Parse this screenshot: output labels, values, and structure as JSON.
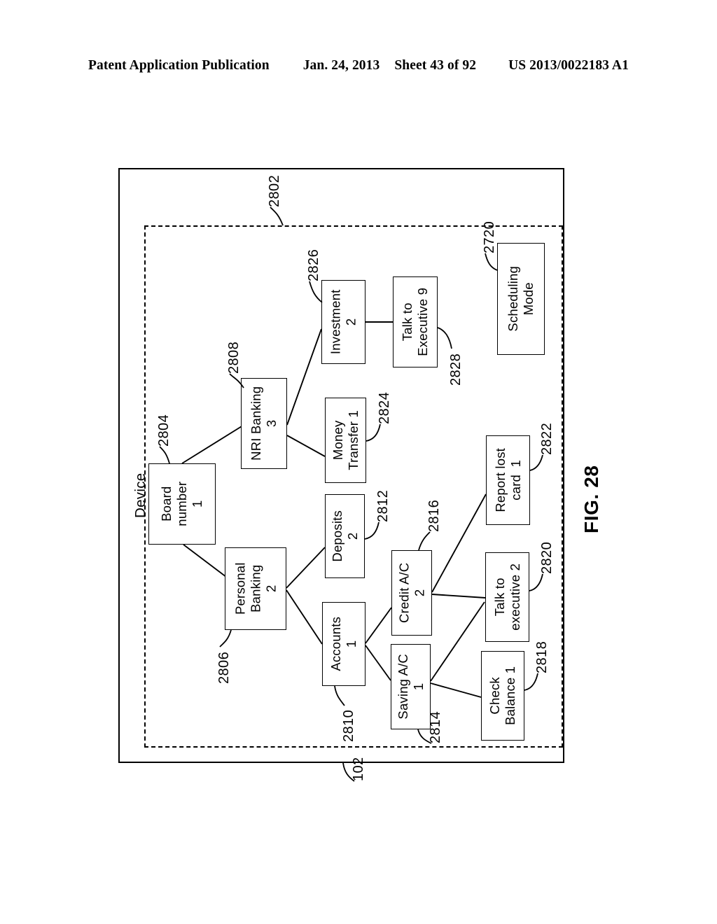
{
  "header": {
    "publication": "Patent Application Publication",
    "date": "Jan. 24, 2013",
    "sheet": "Sheet 43 of 92",
    "number": "US 2013/0022183 A1"
  },
  "figure": {
    "label": "FIG. 28",
    "device_label": "Device",
    "outer_frame_ref": "102",
    "inner_frame_ref": "2802"
  },
  "nodes": [
    {
      "id": "board-number",
      "text": "Board\nnumber\n1",
      "ref": "2804"
    },
    {
      "id": "nri-banking",
      "text": "NRI Banking\n3",
      "ref": "2808"
    },
    {
      "id": "personal-banking",
      "text": "Personal\nBanking\n2",
      "ref": "2806"
    },
    {
      "id": "investment",
      "text": "Investment\n2",
      "ref": "2826"
    },
    {
      "id": "money-transfer",
      "text": "Money\nTransfer 1",
      "ref": "2824"
    },
    {
      "id": "talk-to-executive-9",
      "text": "Talk to\nExecutive 9",
      "ref": "2828"
    },
    {
      "id": "deposits",
      "text": "Deposits\n2",
      "ref": "2812"
    },
    {
      "id": "accounts",
      "text": "Accounts\n1",
      "ref": "2810"
    },
    {
      "id": "credit-ac",
      "text": "Credit A/C\n2",
      "ref": "2816"
    },
    {
      "id": "saving-ac",
      "text": "Saving A/C\n1",
      "ref": "2814"
    },
    {
      "id": "report-lost-card",
      "text": "Report lost\ncard  1",
      "ref": "2822"
    },
    {
      "id": "talk-to-executive-2",
      "text": "Talk to\nexecutive 2",
      "ref": "2820"
    },
    {
      "id": "check-balance",
      "text": "Check\nBalance 1",
      "ref": "2818"
    },
    {
      "id": "scheduling-mode",
      "text": "Scheduling\nMode",
      "ref": "2720"
    }
  ],
  "edges": [
    {
      "from": "board-number",
      "to": "nri-banking"
    },
    {
      "from": "board-number",
      "to": "personal-banking"
    },
    {
      "from": "nri-banking",
      "to": "investment"
    },
    {
      "from": "nri-banking",
      "to": "money-transfer"
    },
    {
      "from": "investment",
      "to": "talk-to-executive-9"
    },
    {
      "from": "personal-banking",
      "to": "deposits"
    },
    {
      "from": "personal-banking",
      "to": "accounts"
    },
    {
      "from": "accounts",
      "to": "credit-ac"
    },
    {
      "from": "accounts",
      "to": "saving-ac"
    },
    {
      "from": "credit-ac",
      "to": "report-lost-card"
    },
    {
      "from": "credit-ac",
      "to": "talk-to-executive-2"
    },
    {
      "from": "saving-ac",
      "to": "talk-to-executive-2"
    },
    {
      "from": "saving-ac",
      "to": "check-balance"
    }
  ]
}
